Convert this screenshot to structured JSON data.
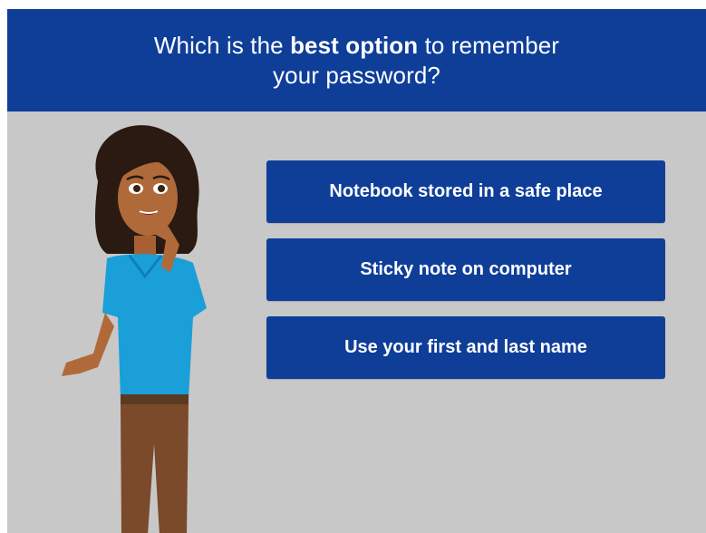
{
  "question": {
    "line1_pre": "Which is the ",
    "line1_bold": "best option",
    "line1_post": " to remember",
    "line2": "your password?"
  },
  "options": [
    {
      "label": "Notebook stored in a safe place"
    },
    {
      "label": "Sticky note on computer"
    },
    {
      "label": "Use your first and last name"
    }
  ],
  "colors": {
    "header_bg": "#0f3e99",
    "stage_bg": "#c8c8c8",
    "option_bg": "#0f3e99",
    "shirt": "#1a9fd9",
    "pants": "#7a4a2a",
    "skin": "#b06a3a",
    "hair": "#2a1a12"
  },
  "icons": {
    "character": "woman-thinking-illustration"
  }
}
